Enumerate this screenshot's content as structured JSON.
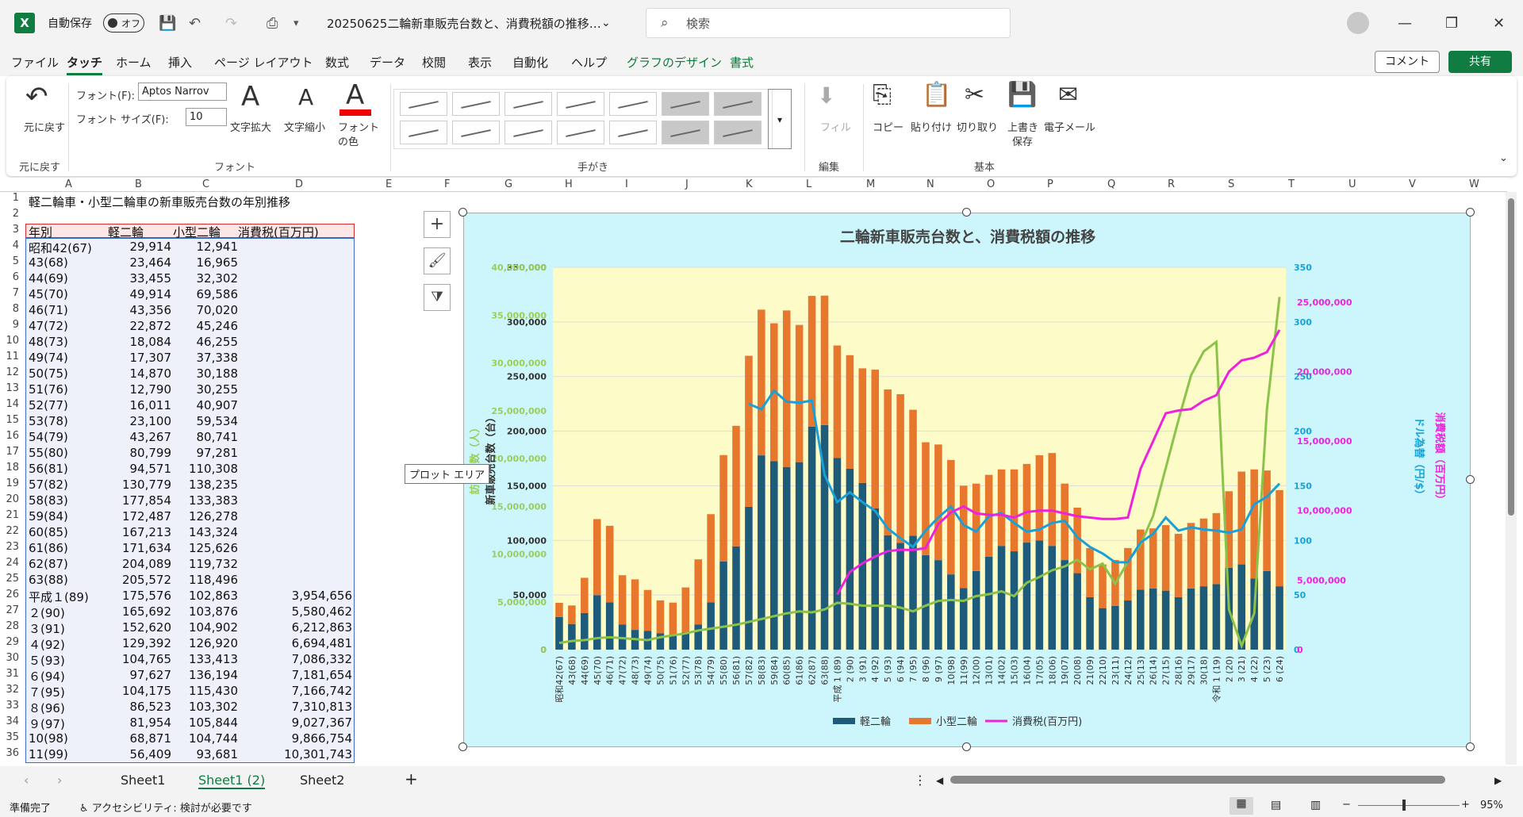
{
  "app": {
    "logo": "X",
    "autosave_label": "自動保存",
    "autosave_state": "オフ",
    "doc_title": "20250625二輪新車販売台数と、消費税額の推移…",
    "search_placeholder": "検索",
    "comment": "コメント",
    "share": "共有"
  },
  "menu": [
    "ファイル",
    "タッチ",
    "ホーム",
    "挿入",
    "ページ レイアウト",
    "数式",
    "データ",
    "校閲",
    "表示",
    "自動化",
    "ヘルプ",
    "グラフのデザイン",
    "書式"
  ],
  "ribbon": {
    "undo": "元に戻す",
    "undo_group": "元に戻す",
    "font_label": "フォント(F):",
    "font_value": "Aptos Narrov",
    "size_label": "フォント サイズ(F):",
    "size_value": "10",
    "grow": "文字拡大",
    "shrink": "文字縮小",
    "color1": "フォント",
    "color2": "の色",
    "font_group": "フォント",
    "ink_group": "手がき",
    "fill": "フィル",
    "edit_group": "編集",
    "copy": "コピー",
    "paste": "貼り付け",
    "cut": "切り取り",
    "save1": "上書き",
    "save2": "保存",
    "mail": "電子メール",
    "basic_group": "基本"
  },
  "columns": [
    "A",
    "B",
    "C",
    "D",
    "E",
    "F",
    "G",
    "H",
    "I",
    "J",
    "K",
    "L",
    "M",
    "N",
    "O",
    "P",
    "Q",
    "R",
    "S",
    "T",
    "U",
    "V",
    "W"
  ],
  "sheet": {
    "title": "軽二輪車・小型二輪車の新車販売台数の年別推移",
    "headers": [
      "年別",
      "軽二輪",
      "小型二輪",
      "消費税(百万円)"
    ],
    "rows": [
      [
        "昭和42(67)",
        "29,914",
        "12,941",
        ""
      ],
      [
        "43(68)",
        "23,464",
        "16,965",
        ""
      ],
      [
        "44(69)",
        "33,455",
        "32,302",
        ""
      ],
      [
        "45(70)",
        "49,914",
        "69,586",
        ""
      ],
      [
        "46(71)",
        "43,356",
        "70,020",
        ""
      ],
      [
        "47(72)",
        "22,872",
        "45,246",
        ""
      ],
      [
        "48(73)",
        "18,084",
        "46,255",
        ""
      ],
      [
        "49(74)",
        "17,307",
        "37,338",
        ""
      ],
      [
        "50(75)",
        "14,870",
        "30,188",
        ""
      ],
      [
        "51(76)",
        "12,790",
        "30,255",
        ""
      ],
      [
        "52(77)",
        "16,011",
        "40,907",
        ""
      ],
      [
        "53(78)",
        "23,100",
        "59,534",
        ""
      ],
      [
        "54(79)",
        "43,267",
        "80,741",
        ""
      ],
      [
        "55(80)",
        "80,799",
        "97,281",
        ""
      ],
      [
        "56(81)",
        "94,571",
        "110,308",
        ""
      ],
      [
        "57(82)",
        "130,779",
        "138,235",
        ""
      ],
      [
        "58(83)",
        "177,854",
        "133,383",
        ""
      ],
      [
        "59(84)",
        "172,487",
        "126,278",
        ""
      ],
      [
        "60(85)",
        "167,213",
        "143,324",
        ""
      ],
      [
        "61(86)",
        "171,634",
        "125,626",
        ""
      ],
      [
        "62(87)",
        "204,089",
        "119,732",
        ""
      ],
      [
        "63(88)",
        "205,572",
        "118,496",
        ""
      ],
      [
        "平成１(89)",
        "175,576",
        "102,863",
        "3,954,656"
      ],
      [
        "２(90)",
        "165,692",
        "103,876",
        "5,580,462"
      ],
      [
        "３(91)",
        "152,620",
        "104,902",
        "6,212,863"
      ],
      [
        "４(92)",
        "129,392",
        "126,920",
        "6,694,481"
      ],
      [
        "５(93)",
        "104,765",
        "133,413",
        "7,086,332"
      ],
      [
        "６(94)",
        "97,627",
        "136,194",
        "7,181,654"
      ],
      [
        "７(95)",
        "104,175",
        "115,430",
        "7,166,742"
      ],
      [
        "８(96)",
        "86,523",
        "103,302",
        "7,310,813"
      ],
      [
        "９(97)",
        "81,954",
        "105,844",
        "9,027,367"
      ],
      [
        "10(98)",
        "68,871",
        "104,744",
        "9,866,754"
      ],
      [
        "11(99)",
        "56,409",
        "93,681",
        "10,301,743"
      ]
    ]
  },
  "chart_data": {
    "type": "bar",
    "title": "二輪新車販売台数と、消費税額の推移",
    "y_left_label": "新車販売台数（台）",
    "y_left2_label": "訪日客数（人）",
    "y_right_label": "ドル為替（円/$）",
    "y_right2_label": "消費税額（百万円）",
    "y_left_ticks": [
      "0",
      "50,000",
      "100,000",
      "150,000",
      "200,000",
      "250,000",
      "300,000",
      "350,000"
    ],
    "y_left2_ticks": [
      "0",
      "5,000,000",
      "10,000,000",
      "15,000,000",
      "20,000,000",
      "25,000,000",
      "30,000,000",
      "35,000,000",
      "40,000,000"
    ],
    "y_right_ticks": [
      "0",
      "50",
      "100",
      "150",
      "200",
      "250",
      "300",
      "350"
    ],
    "y_right2_ticks": [
      "0",
      "5,000,000",
      "10,000,000",
      "15,000,000",
      "20,000,000",
      "25,000,000"
    ],
    "ylim": [
      0,
      350000
    ],
    "categories": [
      "昭和42(67)",
      "43(68)",
      "44(69)",
      "45(70)",
      "46(71)",
      "47(72)",
      "48(73)",
      "49(74)",
      "50(75)",
      "51(76)",
      "52(77)",
      "53(78)",
      "54(79)",
      "55(80)",
      "56(81)",
      "57(82)",
      "58(83)",
      "59(84)",
      "60(85)",
      "61(86)",
      "62(87)",
      "63(88)",
      "平成 1 (89)",
      "2 (90)",
      "3 (91)",
      "4 (92)",
      "5 (93)",
      "6 (94)",
      "7 (95)",
      "8 (96)",
      "9 (97)",
      "10(98)",
      "11(99)",
      "12(00)",
      "13(01)",
      "14(02)",
      "15(03)",
      "16(04)",
      "17(05)",
      "18(06)",
      "19(07)",
      "20(08)",
      "21(09)",
      "22(10)",
      "23(11)",
      "24(12)",
      "25(13)",
      "26(14)",
      "27(15)",
      "28(16)",
      "29(17)",
      "30(18)",
      "令和 1 (19)",
      "2 (20)",
      "3 (21)",
      "4 (22)",
      "5 (23)",
      "6 (24)"
    ],
    "series": [
      {
        "name": "軽二輪",
        "color": "#1e5b7b",
        "values": [
          29914,
          23464,
          33455,
          49914,
          43356,
          22872,
          18084,
          17307,
          14870,
          12790,
          16011,
          23100,
          43267,
          80799,
          94571,
          130779,
          177854,
          172487,
          167213,
          171634,
          204089,
          205572,
          175576,
          165692,
          152620,
          129392,
          104765,
          97627,
          104175,
          86523,
          81954,
          68871,
          56409,
          72000,
          85000,
          95000,
          90000,
          98000,
          100000,
          95000,
          82000,
          70000,
          48000,
          38000,
          40000,
          45000,
          55000,
          56000,
          54000,
          48000,
          56000,
          58000,
          60000,
          75000,
          78000,
          65000,
          72000,
          58000
        ]
      },
      {
        "name": "小型二輪",
        "color": "#e8772e",
        "values": [
          12941,
          16965,
          32302,
          69586,
          70020,
          45246,
          46255,
          37338,
          30188,
          30255,
          40907,
          59534,
          80741,
          97281,
          110308,
          138235,
          133383,
          126278,
          143324,
          125626,
          119732,
          118496,
          102863,
          103876,
          104902,
          126920,
          133413,
          136194,
          115430,
          103302,
          105844,
          104744,
          93681,
          80000,
          75000,
          70000,
          75000,
          72000,
          78000,
          85000,
          70000,
          60000,
          45000,
          40000,
          42000,
          48000,
          55000,
          55000,
          60000,
          58000,
          60000,
          62000,
          65000,
          70000,
          85000,
          100000,
          92000,
          88000
        ]
      },
      {
        "name": "消費税(百万円)",
        "color": "#ee22dd",
        "values": [
          null,
          null,
          null,
          null,
          null,
          null,
          null,
          null,
          null,
          null,
          null,
          null,
          null,
          null,
          null,
          null,
          null,
          null,
          null,
          null,
          null,
          null,
          3954656,
          5580462,
          6212863,
          6694481,
          7086332,
          7181654,
          7166742,
          7310813,
          9027367,
          9866754,
          10301743,
          9800000,
          9700000,
          9700000,
          9500000,
          9900000,
          10000000,
          10000000,
          9800000,
          9600000,
          9500000,
          9400000,
          9400000,
          9500000,
          13000000,
          15000000,
          17000000,
          17200000,
          17300000,
          17900000,
          18300000,
          20000000,
          20800000,
          21000000,
          21400000,
          23000000
        ]
      },
      {
        "values": [
          null,
          null,
          null,
          null,
          null,
          null,
          null,
          null,
          null,
          null,
          null,
          null,
          null,
          null,
          null,
          225,
          220,
          237,
          227,
          226,
          228,
          160,
          135,
          144,
          135,
          127,
          111,
          102,
          94,
          109,
          121,
          131,
          114,
          108,
          122,
          125,
          116,
          108,
          110,
          116,
          118,
          103,
          94,
          88,
          80,
          80,
          98,
          106,
          121,
          109,
          112,
          110,
          109,
          107,
          110,
          133,
          140,
          152
        ]
      },
      {
        "values": [
          700000,
          900000,
          1000000,
          1200000,
          1300000,
          1200000,
          1100000,
          1000000,
          1300000,
          1500000,
          1700000,
          2000000,
          2200000,
          2400000,
          2600000,
          2900000,
          3200000,
          3500000,
          3800000,
          4000000,
          3900000,
          4200000,
          4900000,
          4800000,
          4600000,
          4600000,
          4600000,
          4400000,
          4000000,
          4600000,
          5100000,
          5200000,
          5100000,
          5600000,
          5800000,
          6100000,
          5600000,
          7000000,
          7600000,
          8300000,
          8700000,
          9400000,
          8400000,
          9000000,
          6900000,
          9200000,
          11000000,
          14000000,
          19000000,
          24000000,
          28700000,
          31200000,
          32200000,
          4200000,
          400000,
          3800000,
          25100000,
          36900000
        ]
      }
    ]
  }
}
